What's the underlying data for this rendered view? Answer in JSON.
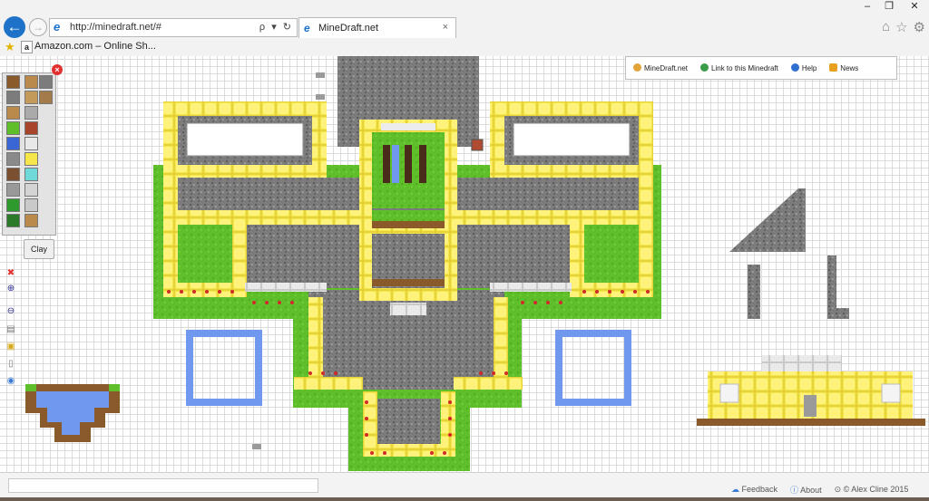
{
  "browser": {
    "address_url": "http://minedraft.net/#",
    "address_tools": "ρ ▾ ↻",
    "tab_title": "MineDraft.net",
    "tab_close": "×",
    "favorites": [
      {
        "label": "Amazon.com – Online Sh..."
      }
    ],
    "window_buttons": [
      "‒",
      "❐",
      "✕"
    ],
    "right_icons": [
      "⌂",
      "☆",
      "⚙"
    ]
  },
  "toolbar": {
    "links": [
      {
        "label": "MineDraft.net",
        "icon": "home-icon"
      },
      {
        "label": "Link to this Minedraft",
        "icon": "link-icon"
      },
      {
        "label": "Help",
        "icon": "help-icon"
      },
      {
        "label": "News",
        "icon": "news-icon"
      }
    ]
  },
  "palette": {
    "selected_tooltip": "Clay",
    "close_label": "×",
    "side_tools": [
      {
        "name": "delete-tool",
        "glyph": "✖",
        "color": "#e23030"
      },
      {
        "name": "zoom-in-tool",
        "glyph": "⊕",
        "color": "#2a2a8a"
      },
      {
        "name": "zoom-out-tool",
        "glyph": "⊖",
        "color": "#2a2a8a"
      },
      {
        "name": "new-file-tool",
        "glyph": "▤",
        "color": "#777777"
      },
      {
        "name": "folder-tool",
        "glyph": "▣",
        "color": "#d7a91f"
      },
      {
        "name": "page-tool",
        "glyph": "▯",
        "color": "#777777"
      },
      {
        "name": "eye-tool",
        "glyph": "◉",
        "color": "#3a7bd5"
      }
    ]
  },
  "footer": {
    "links": [
      {
        "label": "Feedback",
        "icon": "speech-bubble-icon"
      },
      {
        "label": "About",
        "icon": "info-icon"
      },
      {
        "label": "© Alex Cline 2015",
        "icon": "copyright-icon"
      }
    ]
  },
  "colors": {
    "grass": "#5fbf2a",
    "gold": "#f6e64a",
    "stone": "#7a7a7a",
    "water": "#7098ee",
    "dirt": "#8a5a2b",
    "quartz": "#ececec",
    "flower_red": "#d22828"
  }
}
